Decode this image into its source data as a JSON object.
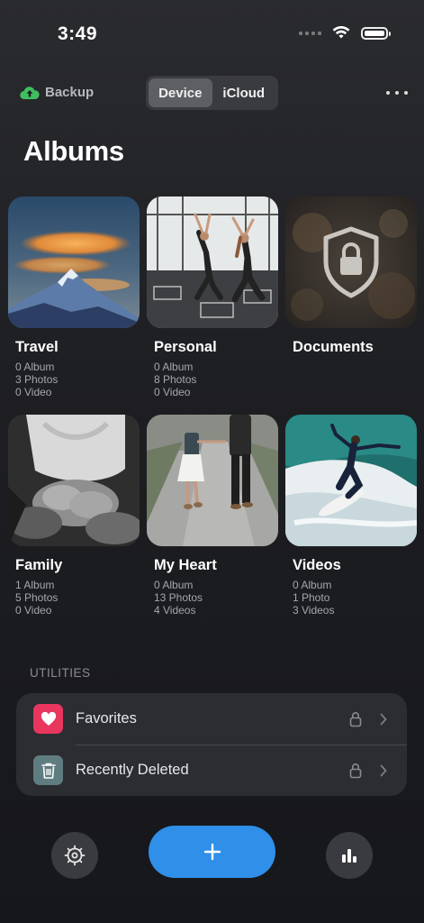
{
  "status": {
    "time": "3:49"
  },
  "header": {
    "backup_label": "Backup",
    "segments": [
      "Device",
      "iCloud"
    ],
    "active_segment": "Device",
    "title": "Albums"
  },
  "albums": [
    {
      "name": "Travel",
      "albums": "0 Album",
      "photos": "3 Photos",
      "videos": "0 Video",
      "thumb": "mountain-photo"
    },
    {
      "name": "Personal",
      "albums": "0 Album",
      "photos": "8 Photos",
      "videos": "0 Video",
      "thumb": "fitness-photo"
    },
    {
      "name": "Documents",
      "albums": "",
      "photos": "",
      "videos": "",
      "thumb": "locked-shield"
    },
    {
      "name": "Family",
      "albums": "1 Album",
      "photos": "5 Photos",
      "videos": "0 Video",
      "thumb": "hands-photo"
    },
    {
      "name": "My Heart",
      "albums": "0 Album",
      "photos": "13 Photos",
      "videos": "4 Videos",
      "thumb": "couple-photo"
    },
    {
      "name": "Videos",
      "albums": "0 Album",
      "photos": "1 Photo",
      "videos": "3 Videos",
      "thumb": "surfer-photo"
    }
  ],
  "utilities": {
    "label": "UTILITIES",
    "items": [
      {
        "label": "Favorites",
        "icon": "heart-icon",
        "color": "#e8365e"
      },
      {
        "label": "Recently Deleted",
        "icon": "trash-icon",
        "color": "#5f7d80"
      }
    ]
  },
  "colors": {
    "accent": "#2f8fe9",
    "backup_cloud": "#3fbf5f"
  }
}
